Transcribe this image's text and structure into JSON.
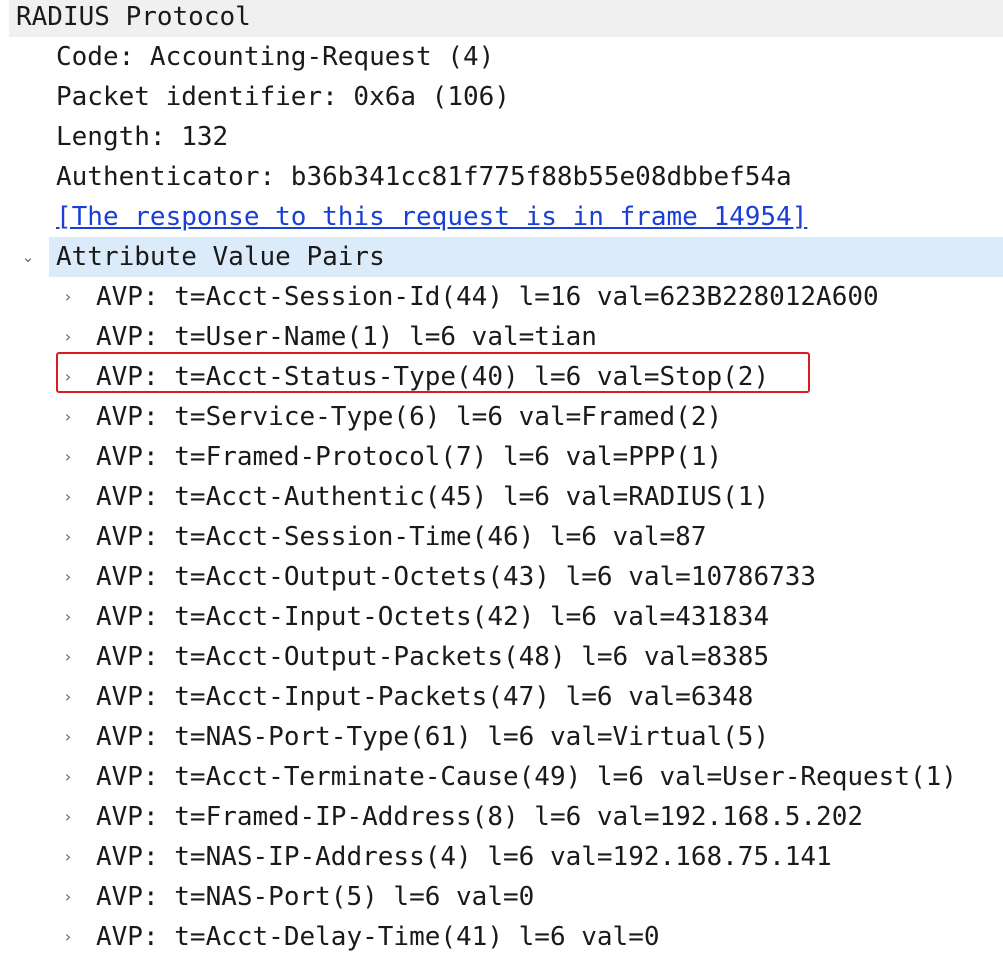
{
  "tree": {
    "header": {
      "label": "RADIUS Protocol"
    },
    "fields": {
      "code": "Code: Accounting-Request (4)",
      "packet_identifier": "Packet identifier: 0x6a (106)",
      "length": "Length: 132",
      "authenticator": "Authenticator: b36b341cc81f775f88b55e08dbbef54a",
      "response_link": "[The response to this request is in frame 14954]"
    },
    "avp_group": {
      "label": "Attribute Value Pairs",
      "expanded": true,
      "expander_glyph": "⌄",
      "collapsed_glyph": "›",
      "items": [
        "AVP: t=Acct-Session-Id(44) l=16 val=623B228012A600",
        "AVP: t=User-Name(1) l=6 val=tian",
        "AVP: t=Acct-Status-Type(40) l=6 val=Stop(2)",
        "AVP: t=Service-Type(6) l=6 val=Framed(2)",
        "AVP: t=Framed-Protocol(7) l=6 val=PPP(1)",
        "AVP: t=Acct-Authentic(45) l=6 val=RADIUS(1)",
        "AVP: t=Acct-Session-Time(46) l=6 val=87",
        "AVP: t=Acct-Output-Octets(43) l=6 val=10786733",
        "AVP: t=Acct-Input-Octets(42) l=6 val=431834",
        "AVP: t=Acct-Output-Packets(48) l=6 val=8385",
        "AVP: t=Acct-Input-Packets(47) l=6 val=6348",
        "AVP: t=NAS-Port-Type(61) l=6 val=Virtual(5)",
        "AVP: t=Acct-Terminate-Cause(49) l=6 val=User-Request(1)",
        "AVP: t=Framed-IP-Address(8) l=6 val=192.168.5.202",
        "AVP: t=NAS-IP-Address(4) l=6 val=192.168.75.141",
        "AVP: t=NAS-Port(5) l=6 val=0",
        "AVP: t=Acct-Delay-Time(41) l=6 val=0"
      ],
      "highlighted_index": 2
    }
  },
  "colors": {
    "header_bg": "#f0f0f0",
    "selected_bg": "#dcebfa",
    "link": "#1a3fd6",
    "highlight_border": "#d91c24",
    "expander": "#6a6a6a"
  }
}
